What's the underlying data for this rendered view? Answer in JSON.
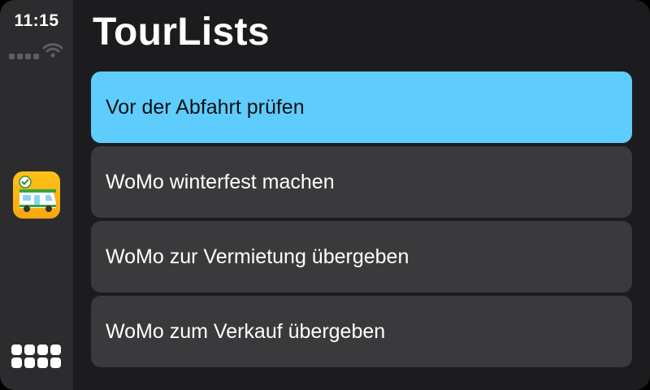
{
  "status": {
    "time": "11:15"
  },
  "app": {
    "title": "TourLists",
    "icon": "camper-van-checklist-icon"
  },
  "lists": [
    {
      "label": "Vor der Abfahrt prüfen",
      "selected": true
    },
    {
      "label": "WoMo winterfest machen",
      "selected": false
    },
    {
      "label": "WoMo zur Vermietung übergeben",
      "selected": false
    },
    {
      "label": "WoMo zum Verkauf übergeben",
      "selected": false
    }
  ],
  "colors": {
    "selected_row": "#5ecdfd",
    "row": "#3a3a3c",
    "background": "#1c1c1e",
    "sidebar": "#2c2c2e",
    "app_icon": "#ffc21a"
  }
}
